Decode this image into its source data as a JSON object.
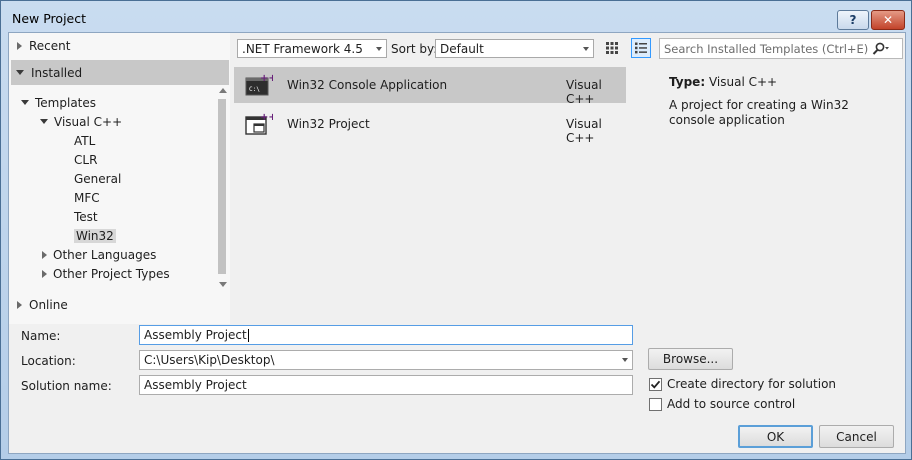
{
  "window": {
    "title": "New Project",
    "help_label": "?",
    "close_label": "✕"
  },
  "nav": {
    "recent": "Recent",
    "installed": "Installed",
    "templates": "Templates",
    "visual_cpp": "Visual C++",
    "children": [
      "ATL",
      "CLR",
      "General",
      "MFC",
      "Test",
      "Win32"
    ],
    "selected_child": "Win32",
    "other_languages": "Other Languages",
    "other_project_types": "Other Project Types",
    "online": "Online"
  },
  "toolbar": {
    "framework": ".NET Framework 4.5",
    "sort_by_label": "Sort by:",
    "sort_by_value": "Default",
    "search_placeholder": "Search Installed Templates (Ctrl+E)"
  },
  "templates": [
    {
      "name": "Win32 Console Application",
      "language": "Visual C++",
      "selected": true,
      "icon": "console-app-icon"
    },
    {
      "name": "Win32 Project",
      "language": "Visual C++",
      "selected": false,
      "icon": "win32-project-icon"
    }
  ],
  "details": {
    "type_label": "Type:",
    "type_value": "Visual C++",
    "description": "A project for creating a Win32 console application"
  },
  "form": {
    "name_label": "Name:",
    "name_value": "Assembly Project",
    "location_label": "Location:",
    "location_value": "C:\\Users\\Kip\\Desktop\\",
    "solution_label": "Solution name:",
    "solution_value": "Assembly Project",
    "browse_label": "Browse...",
    "create_dir_label": "Create directory for solution",
    "create_dir_checked": true,
    "source_control_label": "Add to source control",
    "source_control_checked": false,
    "ok_label": "OK",
    "cancel_label": "Cancel"
  },
  "colors": {
    "title_gradient_top": "#c9dcf0",
    "selection_gray": "#c8c8c8",
    "focus_blue": "#569de5",
    "template_icon_accent": "#68217a",
    "close_button_red": "#c2432a"
  }
}
